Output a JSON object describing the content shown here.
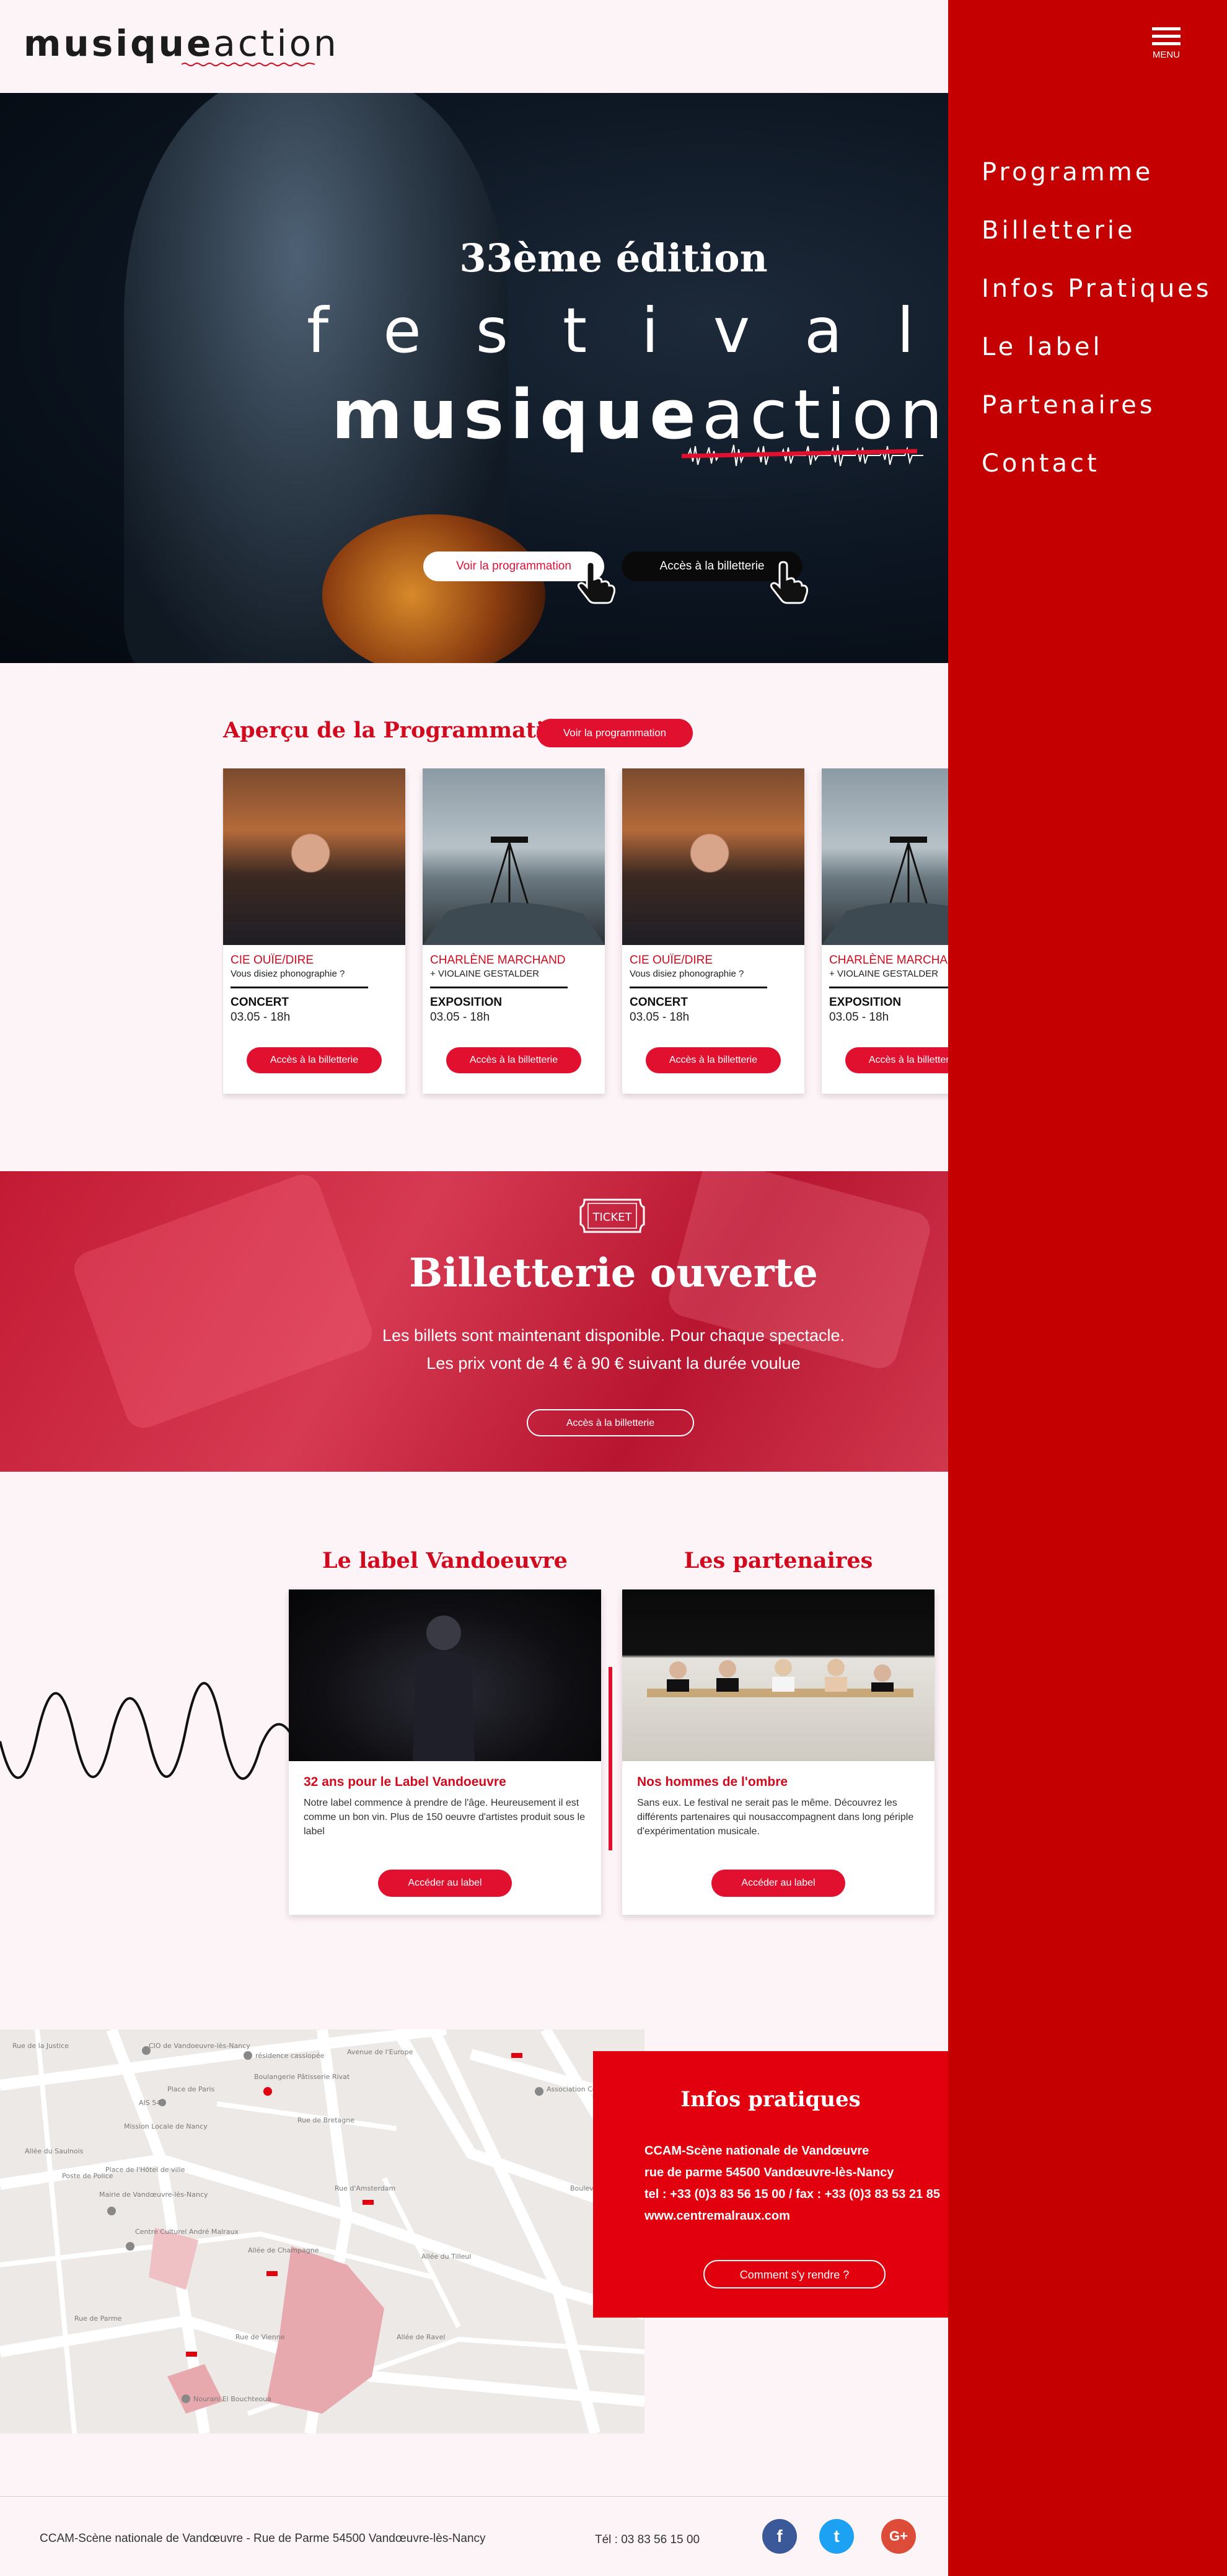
{
  "header": {
    "logo_bold": "musique",
    "logo_light": "action"
  },
  "menu": {
    "button_label": "MENU",
    "items": [
      "Programme",
      "Billetterie",
      "Infos Pratiques",
      "Le label",
      "Partenaires",
      "Contact"
    ]
  },
  "hero": {
    "edition": "33ème édition",
    "festival": "festival",
    "title_bold": "musique",
    "title_light": "action",
    "btn_programmation": "Voir la programmation",
    "btn_billetterie": "Accès à la billetterie"
  },
  "programmation": {
    "title": "Aperçu de la Programmation",
    "button": "Voir la programmation",
    "cards": [
      {
        "name": "CIE OUÏE/DIRE",
        "subtitle": "Vous disiez phonographie ?",
        "kind": "CONCERT",
        "date": "03.05 - 18h",
        "button": "Accès à la billetterie",
        "image": "person"
      },
      {
        "name": "CHARLÈNE MARCHAND",
        "subtitle": "+ VIOLAINE GESTALDER",
        "kind": "EXPOSITION",
        "date": "03.05 - 18h",
        "button": "Accès à la billetterie",
        "image": "landscape"
      },
      {
        "name": "CIE OUÏE/DIRE",
        "subtitle": "Vous disiez phonographie ?",
        "kind": "CONCERT",
        "date": "03.05 - 18h",
        "button": "Accès à la billetterie",
        "image": "person"
      },
      {
        "name": "CHARLÈNE MARCHAND",
        "subtitle": "+ VIOLAINE GESTALDER",
        "kind": "EXPOSITION",
        "date": "03.05 - 18h",
        "button": "Accès à la billetterie",
        "image": "landscape"
      }
    ]
  },
  "billetterie": {
    "icon_text": "TICKET",
    "title": "Billetterie ouverte",
    "line1": "Les billets sont maintenant disponible. Pour chaque spectacle.",
    "line2": "Les prix vont de 4 € à 90 € suivant la durée voulue",
    "button": "Accès à la billetterie"
  },
  "label": {
    "title": "Le label Vandoeuvre",
    "card_title": "32 ans pour le Label Vandoeuvre",
    "text": "Notre label commence à prendre de l'âge. Heureusement il est comme un bon vin. Plus de 150 oeuvre d'artistes produit sous le label",
    "button": "Accéder au label"
  },
  "partenaires": {
    "title": "Les partenaires",
    "card_title": "Nos hommes de l'ombre",
    "text": "Sans eux. Le festival ne serait pas le même. Découvrez les différents partenaires qui nousaccompagnent dans long périple d'expérimentation musicale.",
    "button": "Accéder au label"
  },
  "map": {
    "labels": [
      "CIO de Vandoeuvre-lès-Nancy",
      "résidence cassiopée",
      "Boulangerie Pâtisserie Rivat",
      "AIS 54",
      "Mission Locale de Nancy",
      "Association Couture Serv",
      "Poste de Police",
      "Mairie de Vandœuvre-lès-Nancy",
      "Centre Culturel André Malraux",
      "Nourani El Bouchteoua",
      "Place de Paris",
      "Rue de la Justice",
      "Allée du Saulnois",
      "Place de l'Hôtel de ville",
      "Rue de Parme",
      "Allée de Champagne",
      "Rue de Bretagne",
      "Rue d'Amsterdam",
      "Rue de Vienne",
      "Avenue de l'Europe",
      "Allée du Tilleul",
      "Boulevard de l'Europe",
      "Allée de Ravel"
    ]
  },
  "infos": {
    "title": "Infos pratiques",
    "line1": "CCAM-Scène nationale de Vandœuvre",
    "line2": "rue de parme 54500 Vandœuvre-lès-Nancy",
    "line3": "tel : +33 (0)3 83 56 15 00 / fax : +33 (0)3 83 53 21 85",
    "line4": "www.centremalraux.com",
    "button": "Comment s'y rendre ?"
  },
  "footer": {
    "address": "CCAM-Scène nationale de Vandœuvre  - Rue de Parme 54500 Vandœuvre-lès-Nancy",
    "tel": "Tél : 03 83 56 15 00",
    "social": [
      {
        "icon": "facebook-icon",
        "glyph": "f",
        "color": "#3b5998"
      },
      {
        "icon": "twitter-icon",
        "glyph": "t",
        "color": "#1da1f2"
      },
      {
        "icon": "google-plus-icon",
        "glyph": "G+",
        "color": "#dd4b39"
      }
    ]
  },
  "colors": {
    "accent": "#e0102e",
    "menu_bg": "#c40000",
    "page_bg": "#fdf4f8"
  }
}
